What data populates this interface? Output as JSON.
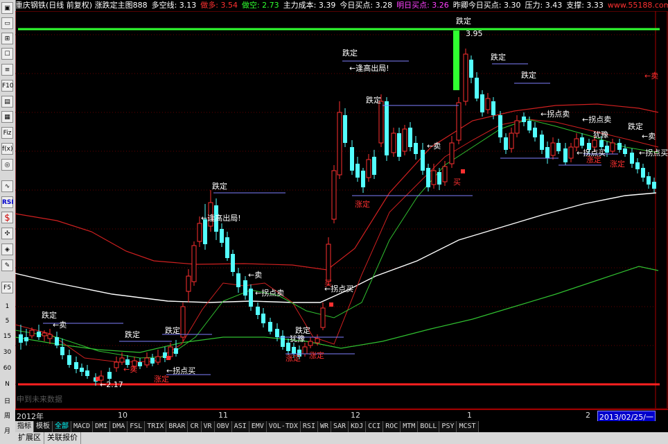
{
  "header": [
    {
      "text": "重庆钢铁(日线 前复权) 涨跌定主图888",
      "color": "#ffffff"
    },
    {
      "text": "多空线: 3.13",
      "color": "#ffffff"
    },
    {
      "text": "做多: 3.54",
      "color": "#ff3030"
    },
    {
      "text": "做空: 2.73",
      "color": "#30ff30"
    },
    {
      "text": "主力成本: 3.39",
      "color": "#ffffff"
    },
    {
      "text": "今日买点: 3.28",
      "color": "#ffffff"
    },
    {
      "text": "明日买点: 3.26",
      "color": "#ff40ff"
    },
    {
      "text": "昨卿今日买点: 3.30",
      "color": "#ffffff"
    },
    {
      "text": "压力: 3.43",
      "color": "#ffffff"
    },
    {
      "text": "支撑: 3.33",
      "color": "#ffffff"
    },
    {
      "text": "www.55188.com",
      "color": "#ff3030"
    }
  ],
  "toolbar": {
    "items": [
      {
        "label": "▣",
        "name": "kline-icon"
      },
      {
        "label": "▭",
        "name": "minute-icon"
      },
      {
        "label": "⊞",
        "name": "grid-icon"
      },
      {
        "label": "☐",
        "name": "window-icon"
      },
      {
        "label": "≡",
        "name": "list-icon"
      },
      {
        "label": "F10",
        "name": "f10-icon"
      },
      {
        "label": "▤",
        "name": "report-icon"
      },
      {
        "label": "▦",
        "name": "sheet-icon"
      },
      {
        "label": "Fiz",
        "name": "formula-icon"
      },
      {
        "label": "f(x)",
        "name": "function-icon"
      },
      {
        "label": "◎",
        "name": "zoom-icon"
      },
      {
        "label": "∿",
        "name": "wave-icon"
      },
      {
        "label": "RSI",
        "name": "rsi-icon"
      },
      {
        "label": "$",
        "name": "money-icon"
      },
      {
        "label": "✣",
        "name": "move-icon"
      },
      {
        "label": "◈",
        "name": "signal-icon"
      },
      {
        "label": "✎",
        "name": "pencil-icon"
      },
      {
        "label": "F5",
        "name": "f5-icon"
      },
      {
        "label": "1",
        "name": "period-1-button"
      },
      {
        "label": "5",
        "name": "period-5-button"
      },
      {
        "label": "15",
        "name": "period-15-button"
      },
      {
        "label": "30",
        "name": "period-30-button"
      },
      {
        "label": "60",
        "name": "period-60-button"
      },
      {
        "label": "N",
        "name": "period-n-button"
      },
      {
        "label": "日",
        "name": "period-day-button"
      },
      {
        "label": "周",
        "name": "period-week-button"
      },
      {
        "label": "月",
        "name": "period-month-button"
      }
    ]
  },
  "timeaxis": {
    "labels": [
      {
        "text": "2012年"
      },
      {
        "text": "10"
      },
      {
        "text": "11"
      },
      {
        "text": "12"
      },
      {
        "text": "1"
      },
      {
        "text": "2"
      }
    ],
    "cursor_date": "2013/02/25/一"
  },
  "future_tag": "申到未来数据",
  "indicators": [
    "指标",
    "模板",
    "全部",
    "MACD",
    "DMI",
    "DMA",
    "FSL",
    "TRIX",
    "BRAR",
    "CR",
    "VR",
    "OBV",
    "ASI",
    "EMV",
    "VOL-TDX",
    "RSI",
    "WR",
    "SAR",
    "KDJ",
    "CCI",
    "ROC",
    "MTM",
    "BOLL",
    "PSY",
    "MCST"
  ],
  "bottom_tabs": [
    "扩展区",
    "关联报价"
  ],
  "annotations": [
    {
      "text": "跌定",
      "color": "#ffffff"
    },
    {
      "text": "←卖",
      "color": "#ffffff"
    },
    {
      "text": "跌定",
      "color": "#ffffff"
    },
    {
      "text": "←卖",
      "color": "#ff3030"
    },
    {
      "text": "跌定",
      "color": "#ffffff"
    },
    {
      "text": "←拐点买",
      "color": "#ffffff"
    },
    {
      "text": "涨定",
      "color": "#ff3030"
    },
    {
      "text": "←2.17",
      "color": "#ffffff"
    },
    {
      "text": "跌定",
      "color": "#ffffff"
    },
    {
      "text": "←逢高出局!",
      "color": "#ffffff"
    },
    {
      "text": "←卖",
      "color": "#ffffff"
    },
    {
      "text": "←拐点卖",
      "color": "#ffffff"
    },
    {
      "text": "跌定",
      "color": "#ffffff"
    },
    {
      "text": "犹豫",
      "color": "#ffffff"
    },
    {
      "text": "涨定",
      "color": "#ff3030"
    },
    {
      "text": "涨定",
      "color": "#ff3030"
    },
    {
      "text": "买",
      "color": "#ff3030"
    },
    {
      "text": "←拐点买",
      "color": "#ffffff"
    },
    {
      "text": "跌定",
      "color": "#ffffff"
    },
    {
      "text": "←逢高出局!",
      "color": "#ffffff"
    },
    {
      "text": "跌定",
      "color": "#ffffff"
    },
    {
      "text": "涨定",
      "color": "#ff3030"
    },
    {
      "text": "←卖",
      "color": "#ffffff"
    },
    {
      "text": "买",
      "color": "#ff3030"
    },
    {
      "text": "跌定",
      "color": "#ffffff"
    },
    {
      "text": "3.95",
      "color": "#ffffff"
    },
    {
      "text": "跌定",
      "color": "#ffffff"
    },
    {
      "text": "跌定",
      "color": "#ffffff"
    },
    {
      "text": "←拐点卖",
      "color": "#ffffff"
    },
    {
      "text": "←拐点卖",
      "color": "#ffffff"
    },
    {
      "text": "犹豫",
      "color": "#ffffff"
    },
    {
      "text": "←拐点买",
      "color": "#ffffff"
    },
    {
      "text": "涨定",
      "color": "#ff3030"
    },
    {
      "text": "涨定",
      "color": "#ff3030"
    },
    {
      "text": "跌定",
      "color": "#ffffff"
    },
    {
      "text": "←卖",
      "color": "#ffffff"
    },
    {
      "text": "←拐点买",
      "color": "#ffffff"
    },
    {
      "text": "←卖",
      "color": "#ff3030"
    }
  ],
  "colors": {
    "bull": "#ff3030",
    "bear": "#54ffff",
    "ma_white": "#ffffff",
    "ma_red": "#d02020",
    "ma_green": "#30c030",
    "resist": "#30ff30",
    "support": "#ff2020"
  }
}
